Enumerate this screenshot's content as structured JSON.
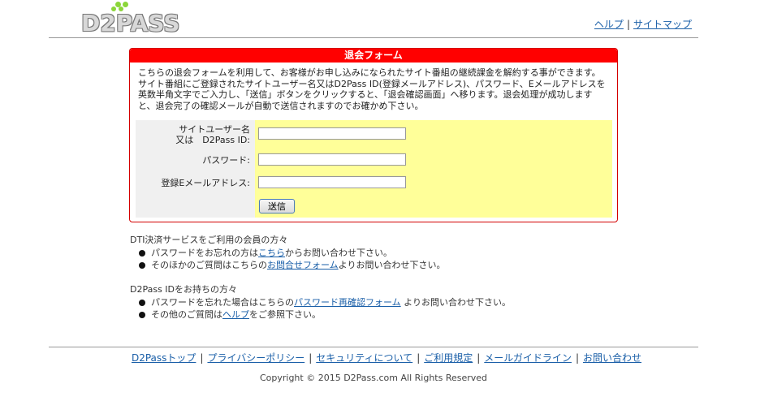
{
  "header": {
    "logo_text": "D2PASS",
    "help_link": "ヘルプ",
    "sitemap_link": "サイトマップ",
    "separator": "|"
  },
  "form": {
    "title": "退会フォーム",
    "description": "こちらの退会フォームを利用して、お客様がお申し込みになられたサイト番組の継続課金を解約する事ができます。サイト番組にご登録されたサイトユーザー名又はD2Pass ID(登録メールアドレス)、パスワード、Eメールアドレスを英数半角文字でご入力し、「送信」ボタンをクリックすると、「退会確認画面」へ移ります。退会処理が成功しますと、退会完了の確認メールが自動で送信されますのでお確かめ下さい。",
    "label_user_line1": "サイトユーザー名",
    "label_user_line2": "又は　D2Pass ID:",
    "label_password": "パスワード:",
    "label_email": "登録Eメールアドレス:",
    "user_value": "",
    "password_value": "",
    "email_value": "",
    "submit_label": "送信"
  },
  "dti_section": {
    "title": "DTI決済サービスをご利用の会員の方々",
    "item1_pre": "パスワードをお忘れの方は",
    "item1_link": "こちら",
    "item1_post": "からお問い合わせ下さい。",
    "item2_pre": "そのほかのご質問はこちらの",
    "item2_link": "お問合せフォーム",
    "item2_post": "よりお問い合わせ下さい。"
  },
  "d2pass_section": {
    "title": "D2Pass IDをお持ちの方々",
    "item1_pre": "パスワードを忘れた場合はこちらの",
    "item1_link": "パスワード再確認フォーム",
    "item1_post": " よりお問い合わせ下さい。",
    "item2_pre": "その他のご質問は",
    "item2_link": "ヘルプ",
    "item2_post": "をご参照下さい。"
  },
  "footer": {
    "links": [
      "D2Passトップ",
      "プライバシーポリシー",
      "セキュリティについて",
      "ご利用規定",
      "メールガイドライン",
      "お問い合わせ"
    ],
    "separator": "|",
    "copyright": "Copyright © 2015 D2Pass.com All Rights Reserved"
  }
}
